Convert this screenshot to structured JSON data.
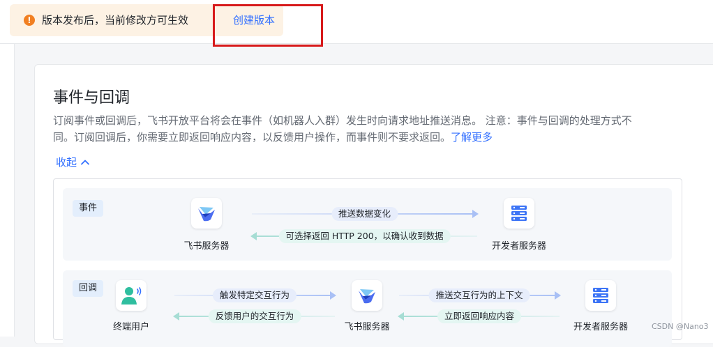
{
  "notice": {
    "icon": "warning-icon",
    "text": "版本发布后，当前修改方可生效",
    "link": "创建版本"
  },
  "section": {
    "title": "事件与回调",
    "description_line1": "订阅事件或回调后，飞书开放平台将会在事件（如机器人入群）发生时向请求地址推送消息。 注意：事件与回调的处理方式不",
    "description_line2": "同。订阅回调后，你需要立即返回响应内容，以反馈用户操作，而事件则不要求返回。",
    "learn_more": "了解更多",
    "collapse": "收起"
  },
  "diagram": {
    "event": {
      "tag": "事件",
      "from_label": "飞书服务器",
      "to_label": "开发者服务器",
      "forward_label": "推送数据变化",
      "backward_label": "可选择返回 HTTP 200，以确认收到数据"
    },
    "callback": {
      "tag": "回调",
      "user_label": "终端用户",
      "server_label": "飞书服务器",
      "dev_label": "开发者服务器",
      "user_to_server": "触发特定交互行为",
      "server_to_user": "反馈用户的交互行为",
      "server_to_dev": "推送交互行为的上下文",
      "dev_to_server": "立即返回响应内容"
    }
  },
  "colors": {
    "accent": "#3370ff",
    "warning": "#f17f21",
    "highlight_border": "#d71a1b",
    "forward_arrow": "#a9c0f5",
    "backward_arrow": "#a6ddd4"
  },
  "watermark": "CSDN @Nano3"
}
